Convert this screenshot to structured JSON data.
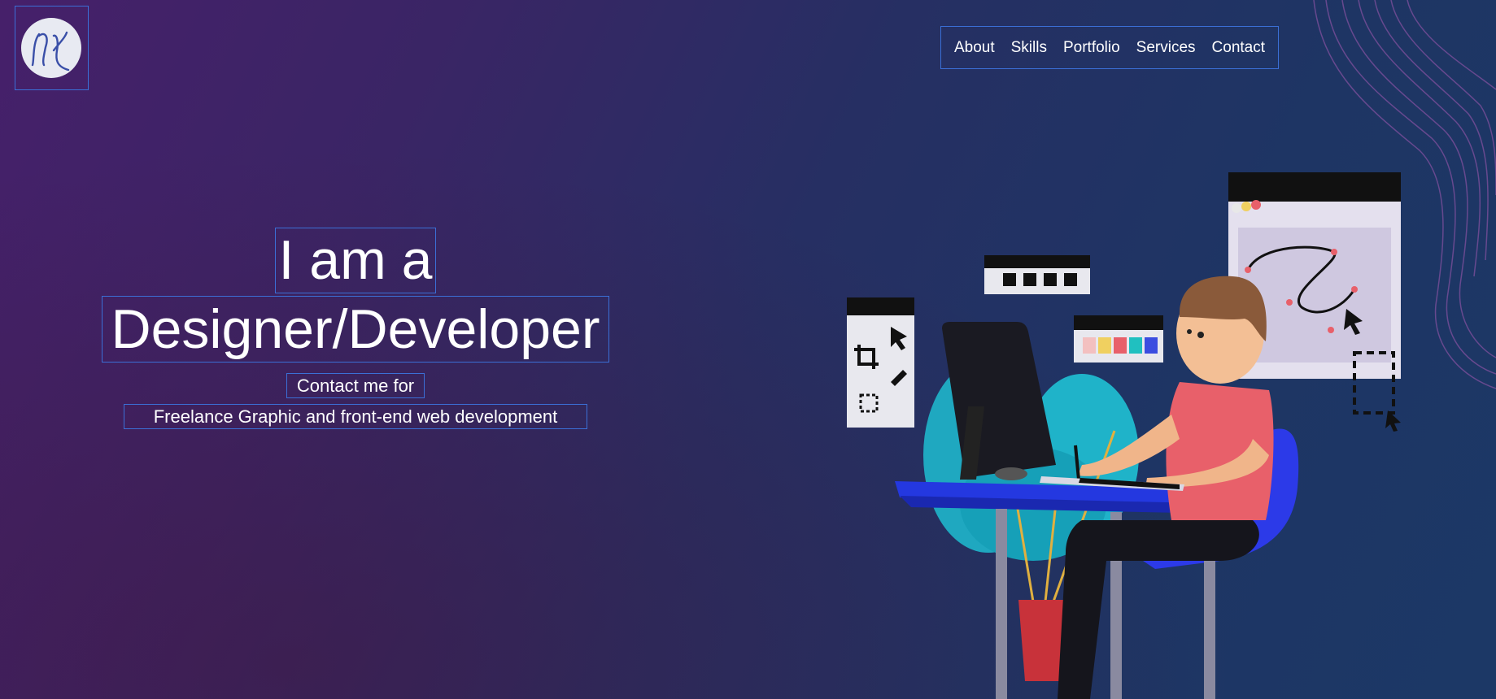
{
  "logo": {
    "alt": "Signature logo"
  },
  "nav": {
    "items": [
      {
        "label": "About"
      },
      {
        "label": "Skills"
      },
      {
        "label": "Portfolio"
      },
      {
        "label": "Services"
      },
      {
        "label": "Contact"
      }
    ]
  },
  "hero": {
    "title_line1": "I am a",
    "title_line2": "Designer/Developer",
    "subtitle_line1": "Contact me for",
    "subtitle_line2": "Freelance Graphic and front-end web development"
  },
  "colors": {
    "accent_outline": "#3b6fd6",
    "shirt": "#e8606a",
    "desk": "#2438e0",
    "plant": "#1fb3c9"
  }
}
